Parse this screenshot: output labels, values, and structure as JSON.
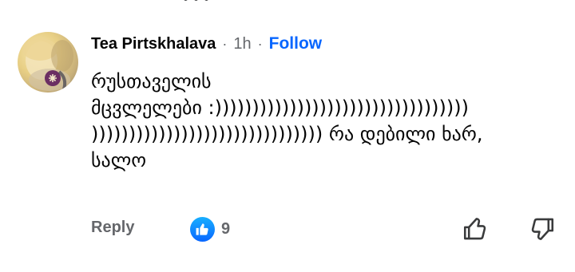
{
  "comment": {
    "author": "Tea Pirtskhalava",
    "separator_1": "·",
    "time": "1h",
    "separator_2": "·",
    "follow_label": "Follow",
    "text_lines": [
      "რუსთაველის",
      "მცვლელები :))))))))))))))))))))))))))))))))))",
      "))))))))))))))))))))))))))))))) რა დებილი ხარ,",
      "სალო"
    ]
  },
  "actions": {
    "reply_label": "Reply",
    "like_count": "9"
  },
  "icons": {
    "avatar": "profile-photo",
    "like_badge": "thumbs-up-icon",
    "react_like": "thumbs-up-outline-icon",
    "react_dislike": "thumbs-down-outline-icon"
  },
  "colors": {
    "link_blue": "#0866ff",
    "secondary_text": "#65676b",
    "primary_text": "#050505"
  }
}
